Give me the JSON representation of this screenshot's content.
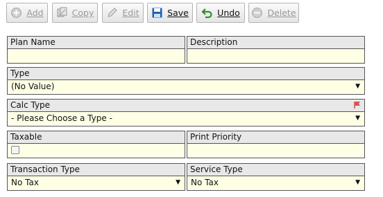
{
  "toolbar": {
    "add": "Add",
    "copy": "Copy",
    "edit": "Edit",
    "save": "Save",
    "undo": "Undo",
    "delete": "Delete"
  },
  "form": {
    "plan_name": {
      "label": "Plan Name",
      "value": ""
    },
    "description": {
      "label": "Description",
      "value": ""
    },
    "type": {
      "label": "Type",
      "value": "(No Value)"
    },
    "calc_type": {
      "label": "Calc Type",
      "value": "- Please Choose a Type -"
    },
    "taxable": {
      "label": "Taxable",
      "checked": false
    },
    "print_priority": {
      "label": "Print Priority",
      "value": ""
    },
    "transaction_type": {
      "label": "Transaction Type",
      "value": "No Tax"
    },
    "service_type": {
      "label": "Service Type",
      "value": "No Tax"
    }
  },
  "colors": {
    "field_bg": "#ffffe6",
    "label_bg": "#e8e8e8",
    "save_icon": "#1f5fb5",
    "undo_icon": "#2f8d2f",
    "flag_icon": "#d9534f"
  }
}
